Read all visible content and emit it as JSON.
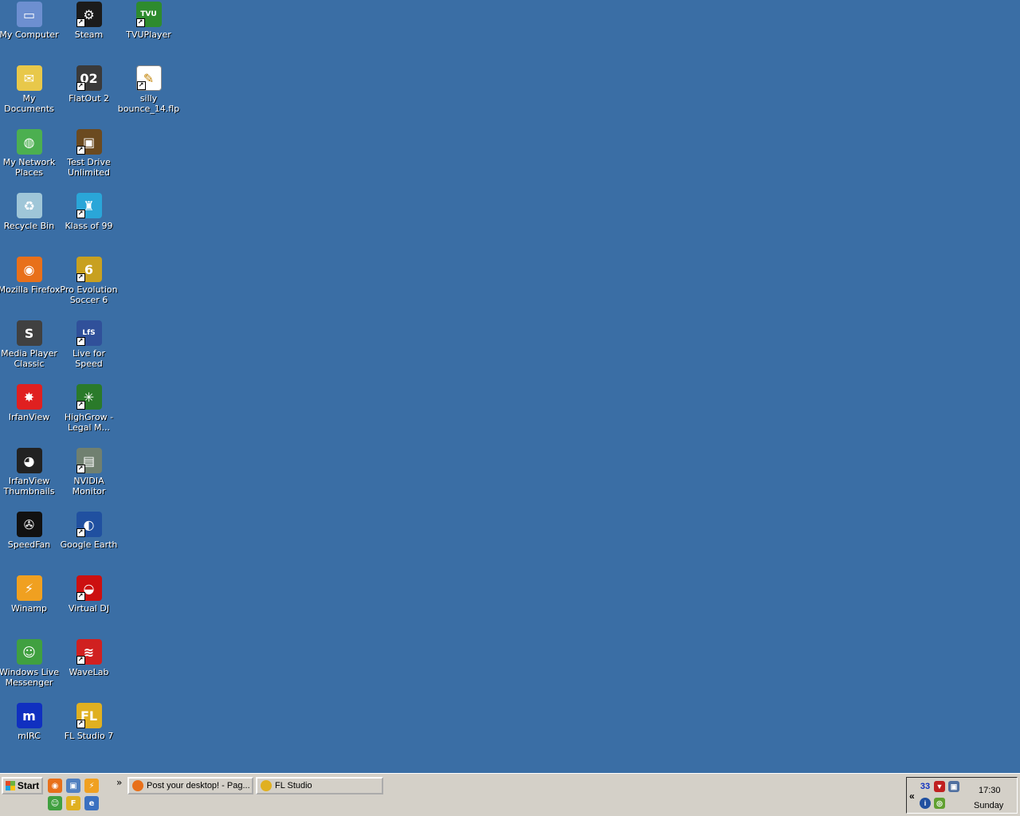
{
  "desktop": {
    "icons": [
      {
        "label": "My Computer",
        "icon": "my-computer-icon",
        "color": "#6d8fd0",
        "glyph": "▭"
      },
      {
        "label": "Steam",
        "icon": "steam-icon",
        "color": "#1b1b1b",
        "glyph": "⚙"
      },
      {
        "label": "TVUPlayer",
        "icon": "tvuplayer-icon",
        "color": "#2e8b2e",
        "glyph": "TVU"
      },
      {
        "label": "My Documents",
        "icon": "my-documents-icon",
        "color": "#e8c84a",
        "glyph": "✉"
      },
      {
        "label": "FlatOut 2",
        "icon": "flatout2-icon",
        "color": "#3a3a3a",
        "glyph": "02"
      },
      {
        "label": "silly bounce_14.flp",
        "icon": "fl-project-file-icon",
        "color": "#ffffff",
        "glyph": "✎"
      },
      {
        "label": "My Network Places",
        "icon": "network-places-icon",
        "color": "#4caf50",
        "glyph": "◍"
      },
      {
        "label": "Test Drive Unlimited",
        "icon": "test-drive-unlimited-icon",
        "color": "#6b4a20",
        "glyph": "▣"
      },
      {
        "label": "Recycle Bin",
        "icon": "recycle-bin-icon",
        "color": "#9fc6d8",
        "glyph": "♻"
      },
      {
        "label": "Klass of 99",
        "icon": "klass-of-99-icon",
        "color": "#2aa6d8",
        "glyph": "♜"
      },
      {
        "label": "Mozilla Firefox",
        "icon": "firefox-icon",
        "color": "#e8701a",
        "glyph": "◉"
      },
      {
        "label": "Pro Evolution Soccer 6",
        "icon": "pes6-icon",
        "color": "#c8a020",
        "glyph": "6"
      },
      {
        "label": "Media Player Classic",
        "icon": "media-player-classic-icon",
        "color": "#404040",
        "glyph": "S"
      },
      {
        "label": "Live for Speed",
        "icon": "live-for-speed-icon",
        "color": "#30509a",
        "glyph": "LfS"
      },
      {
        "label": "IrfanView",
        "icon": "irfanview-icon",
        "color": "#e02020",
        "glyph": "✸"
      },
      {
        "label": "HighGrow - Legal M...",
        "icon": "highgrow-icon",
        "color": "#2a7a2a",
        "glyph": "✳"
      },
      {
        "label": "IrfanView Thumbnails",
        "icon": "irfanview-thumbnails-icon",
        "color": "#222222",
        "glyph": "◕"
      },
      {
        "label": "NVIDIA Monitor",
        "icon": "nvidia-monitor-icon",
        "color": "#708070",
        "glyph": "▤"
      },
      {
        "label": "SpeedFan",
        "icon": "speedfan-icon",
        "color": "#111111",
        "glyph": "✇"
      },
      {
        "label": "Google Earth",
        "icon": "google-earth-icon",
        "color": "#2050a0",
        "glyph": "◐"
      },
      {
        "label": "Winamp",
        "icon": "winamp-icon",
        "color": "#f0a020",
        "glyph": "⚡"
      },
      {
        "label": "Virtual DJ",
        "icon": "virtual-dj-icon",
        "color": "#cc1010",
        "glyph": "◒"
      },
      {
        "label": "Windows Live Messenger",
        "icon": "windows-live-messenger-icon",
        "color": "#40a040",
        "glyph": "☺"
      },
      {
        "label": "WaveLab",
        "icon": "wavelab-icon",
        "color": "#d02020",
        "glyph": "≋"
      },
      {
        "label": "mIRC",
        "icon": "mirc-icon",
        "color": "#1030c0",
        "glyph": "m"
      },
      {
        "label": "FL Studio 7",
        "icon": "fl-studio-7-icon",
        "color": "#e0b020",
        "glyph": "FL"
      }
    ]
  },
  "taskbar": {
    "start_label": "Start",
    "quick_launch": [
      {
        "icon": "firefox-quicklaunch-icon",
        "color": "#e8701a",
        "glyph": "◉"
      },
      {
        "icon": "show-desktop-icon",
        "color": "#5080c0",
        "glyph": "▣"
      },
      {
        "icon": "winamp-quicklaunch-icon",
        "color": "#f0a020",
        "glyph": "⚡"
      },
      {
        "icon": "messenger-quicklaunch-icon",
        "color": "#40a040",
        "glyph": "☺"
      },
      {
        "icon": "fl-studio-quicklaunch-icon",
        "color": "#e0b020",
        "glyph": "F"
      },
      {
        "icon": "ie-quicklaunch-icon",
        "color": "#3a70c0",
        "glyph": "e"
      }
    ],
    "overflow_label": "»",
    "tasks": [
      {
        "label": "Post your desktop! - Pag...",
        "icon": "firefox-task-icon",
        "color": "#e8701a"
      },
      {
        "label": "FL Studio",
        "icon": "fl-studio-task-icon",
        "color": "#e0b020"
      }
    ],
    "tray": {
      "expand_label": "«",
      "temperature": "33",
      "time": "17:30",
      "day": "Sunday"
    }
  }
}
